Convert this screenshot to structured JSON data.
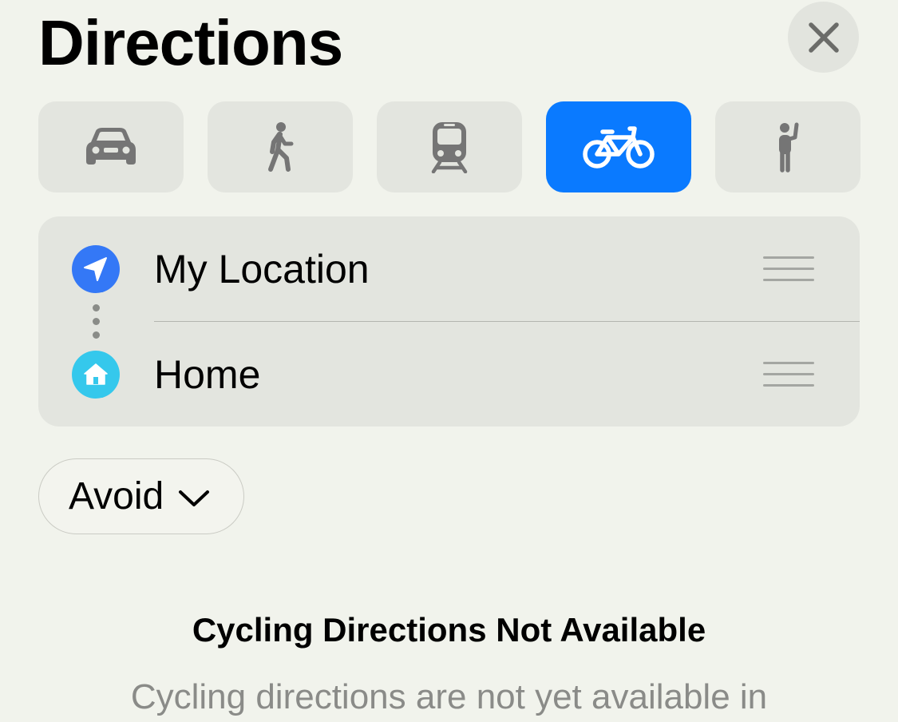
{
  "header": {
    "title": "Directions",
    "close_icon": "close-icon"
  },
  "transport_modes": [
    {
      "name": "drive",
      "icon": "car-icon",
      "selected": false
    },
    {
      "name": "walk",
      "icon": "walking-person-icon",
      "selected": false
    },
    {
      "name": "transit",
      "icon": "train-icon",
      "selected": false
    },
    {
      "name": "cycle",
      "icon": "bicycle-icon",
      "selected": true
    },
    {
      "name": "ride",
      "icon": "hailing-person-icon",
      "selected": false
    }
  ],
  "route": {
    "origin": {
      "label": "My Location",
      "icon": "location-arrow-icon",
      "icon_color": "#3478f6"
    },
    "destination": {
      "label": "Home",
      "icon": "house-icon",
      "icon_color": "#35c8ec"
    }
  },
  "options": {
    "avoid_label": "Avoid"
  },
  "message": {
    "title": "Cycling Directions Not Available",
    "body": "Cycling directions are not yet available in"
  },
  "colors": {
    "accent": "#0a7aff",
    "background": "#f1f3ec",
    "card": "#e3e5df",
    "icon_gray": "#757575"
  }
}
